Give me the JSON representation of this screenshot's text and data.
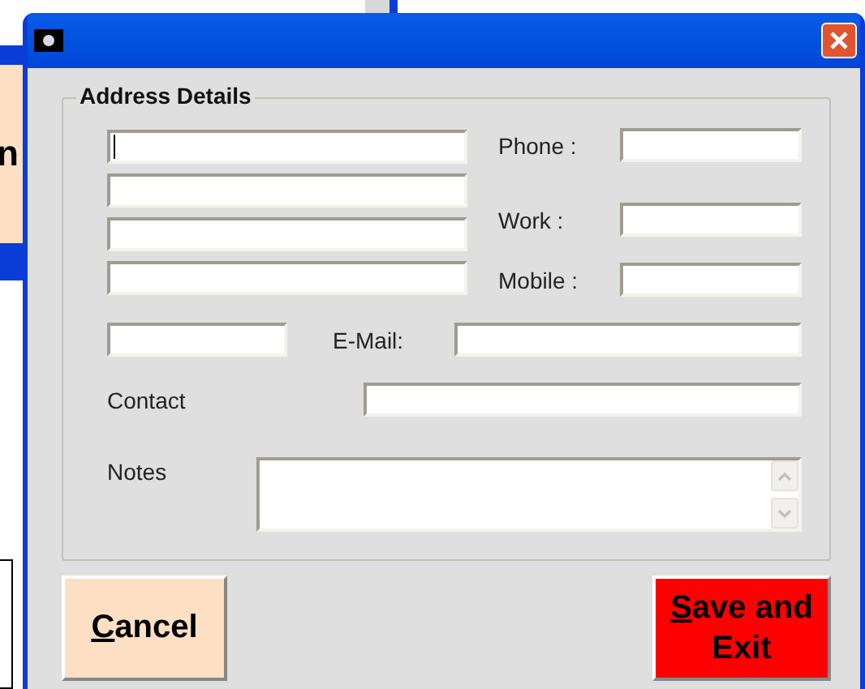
{
  "background": {
    "button_fragment": "n"
  },
  "group": {
    "title": "Address Details",
    "address_fields": [
      {
        "focused": true
      },
      {
        "focused": false
      },
      {
        "focused": false
      },
      {
        "focused": false
      }
    ],
    "postcode_field": {
      "focused": false
    },
    "phone": {
      "label": "Phone :"
    },
    "work": {
      "label": "Work :"
    },
    "mobile": {
      "label": "Mobile :"
    },
    "email": {
      "label": "E-Mail:"
    },
    "contact": {
      "label": "Contact"
    },
    "notes": {
      "label": "Notes"
    }
  },
  "buttons": [
    {
      "kind": "cancel",
      "mnemonic": "C",
      "label": "ancel"
    },
    {
      "kind": "save",
      "mnemonic": "S",
      "label": "ave and Exit"
    }
  ]
}
